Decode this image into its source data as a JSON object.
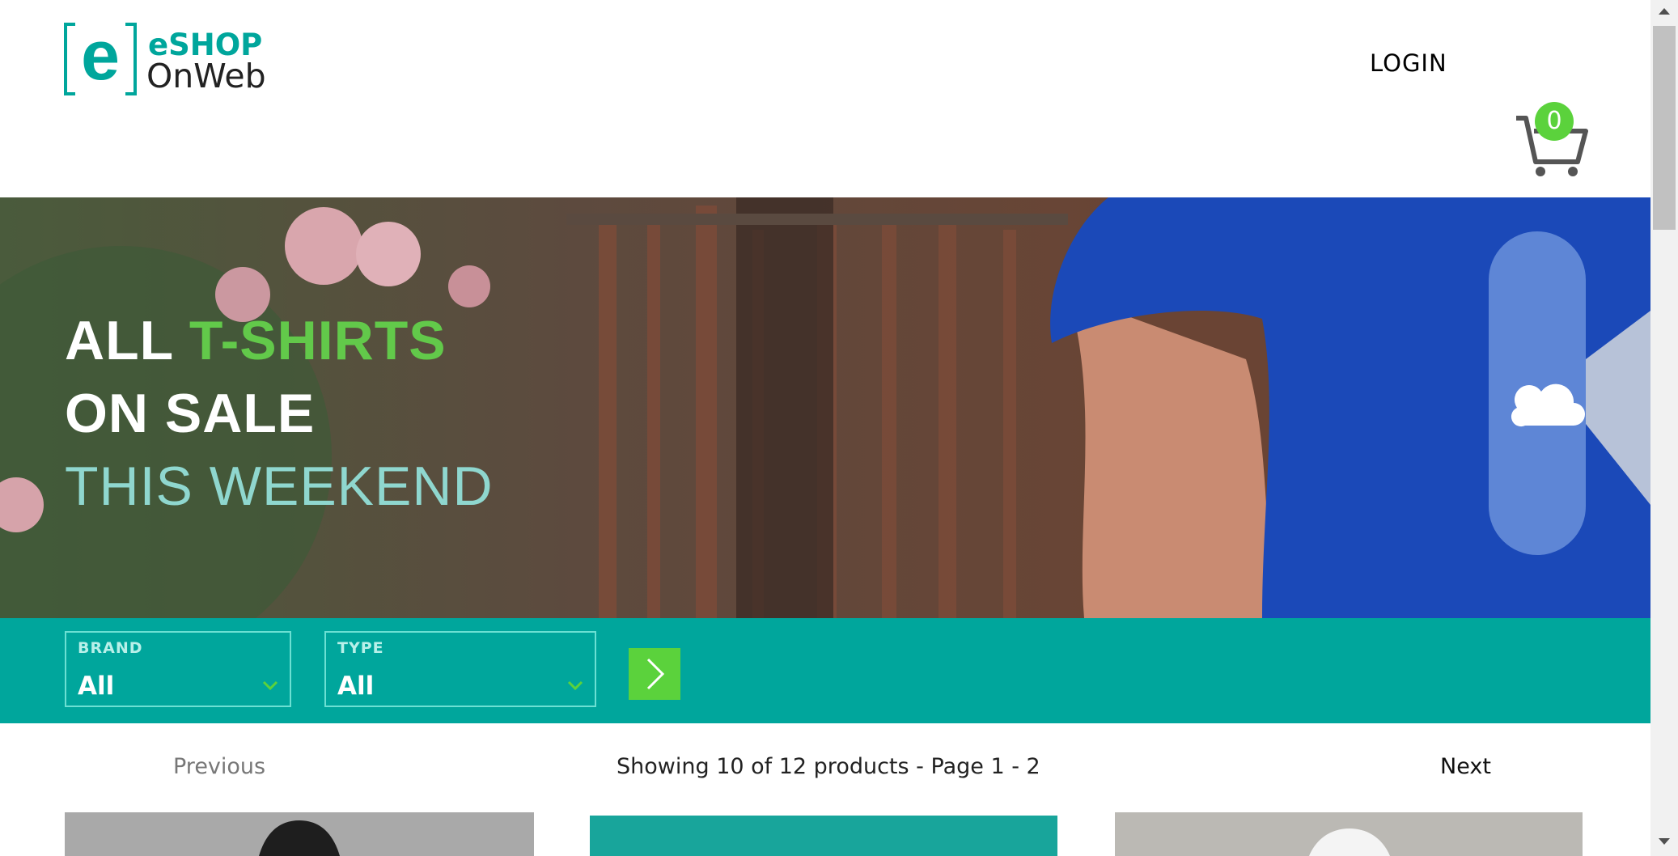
{
  "header": {
    "logo_line1": "eSHOP",
    "logo_line2": "OnWeb",
    "logo_letter": "e",
    "login_label": "LOGIN",
    "cart_count": "0",
    "cart_icon": "shopping-cart-icon"
  },
  "hero": {
    "line1_a": "ALL ",
    "line1_b": "T-SHIRTS",
    "line2": "ON SALE",
    "line3": "THIS WEEKEND"
  },
  "filters": {
    "brand_label": "BRAND",
    "brand_value": "All",
    "type_label": "TYPE",
    "type_value": "All",
    "apply_icon": "chevron-right-icon"
  },
  "pager": {
    "previous": "Previous",
    "info": "Showing 10 of 12 products - Page 1 - 2",
    "next": "Next"
  },
  "colors": {
    "brand_teal": "#00a69c",
    "accent_green": "#5bd23c"
  }
}
